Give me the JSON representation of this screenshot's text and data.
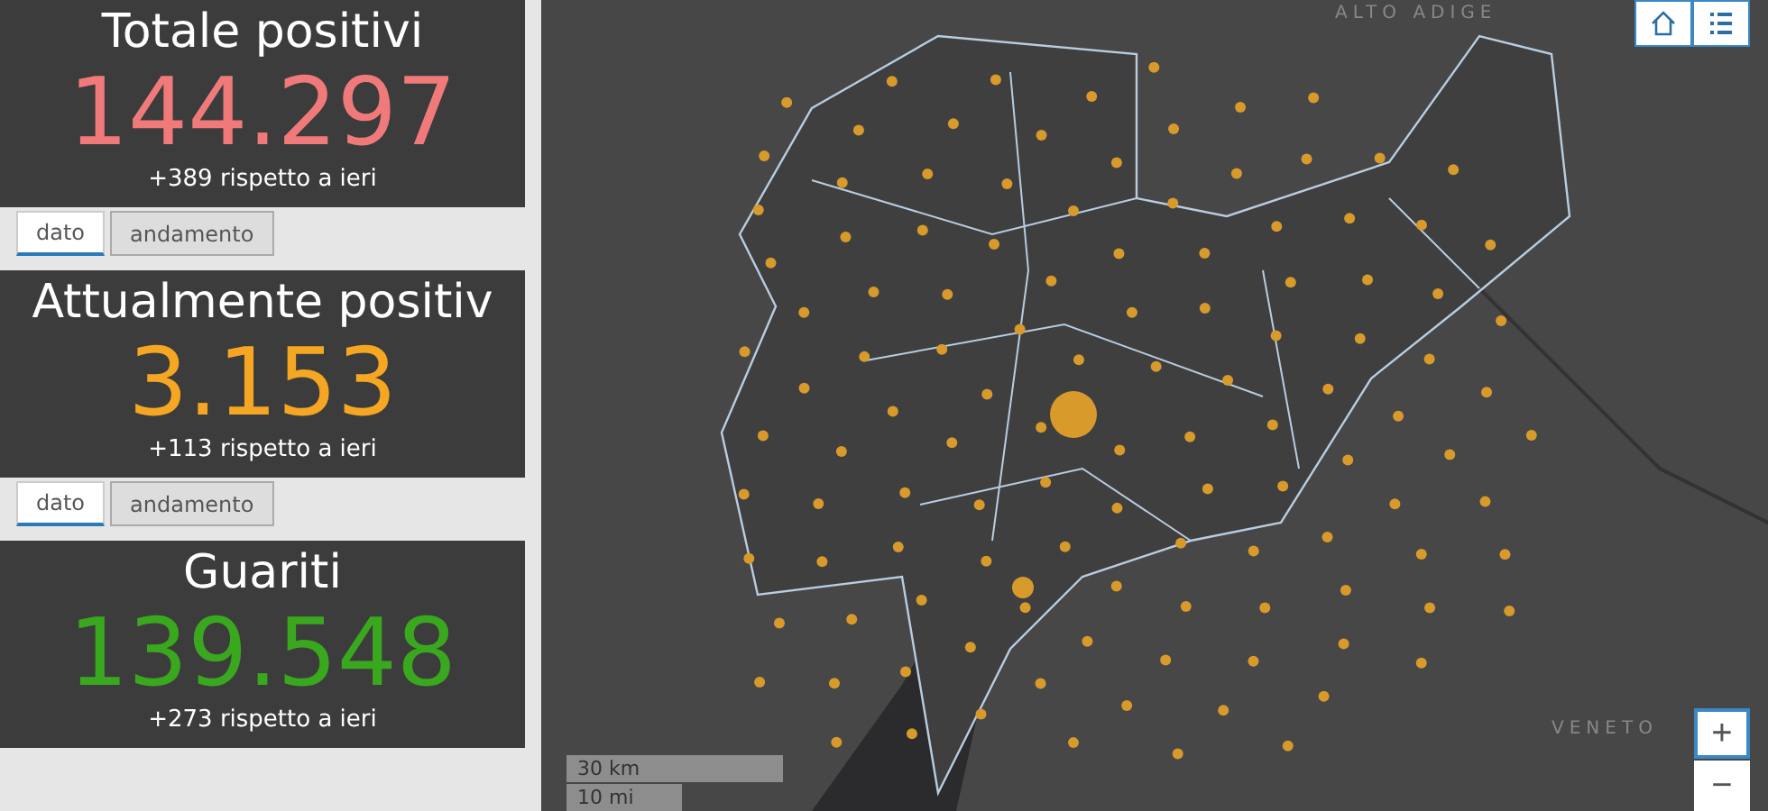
{
  "cards": [
    {
      "title": "Totale positivi",
      "value": "144.297",
      "color": "#f07a7a",
      "delta": "+389 rispetto a ieri",
      "tabs": [
        {
          "label": "dato",
          "selected": true
        },
        {
          "label": "andamento",
          "selected": false
        }
      ]
    },
    {
      "title": "Attualmente positiv",
      "value": "3.153",
      "color": "#f5a623",
      "delta": "+113 rispetto a ieri",
      "tabs": [
        {
          "label": "dato",
          "selected": true
        },
        {
          "label": "andamento",
          "selected": false
        }
      ]
    },
    {
      "title": "Guariti",
      "value": "139.548",
      "color": "#3aa81e",
      "delta": "+273 rispetto a ieri"
    }
  ],
  "map": {
    "region_labels": [
      "ALTO ADIGE",
      "VENETO"
    ],
    "scale": [
      "30 km",
      "10 mi"
    ],
    "zoom_buttons": [
      "+",
      "−"
    ]
  }
}
